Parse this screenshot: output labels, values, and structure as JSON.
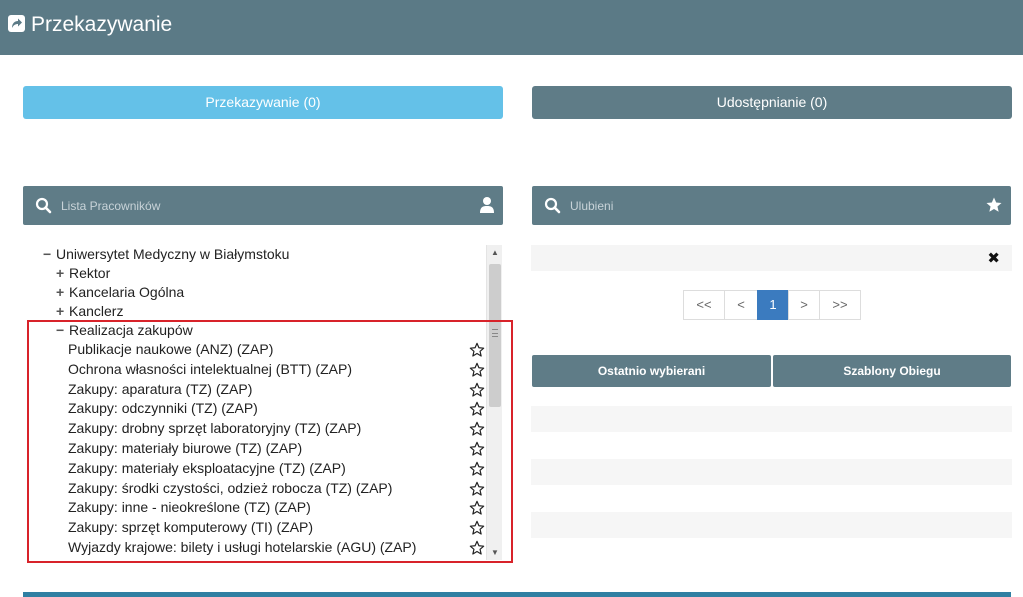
{
  "header": {
    "title": "Przekazywanie",
    "icon": "share-arrow-icon"
  },
  "actions": {
    "transfer_label": "Przekazywanie (0)",
    "share_label": "Udostępnianie (0)"
  },
  "employees_search": {
    "placeholder": "Lista Pracowników",
    "icon": "user-icon"
  },
  "favorites_search": {
    "placeholder": "Ulubieni",
    "icon": "star-icon"
  },
  "tree": {
    "root": "Uniwersytet Medyczny w Białymstoku",
    "nodes": [
      {
        "label": "Rektor",
        "toggle": "+"
      },
      {
        "label": "Kancelaria Ogólna",
        "toggle": "+"
      },
      {
        "label": "Kanclerz",
        "toggle": "+"
      },
      {
        "label": "Realizacja zakupów",
        "toggle": "−"
      }
    ],
    "items": [
      "Publikacje naukowe (ANZ) (ZAP)",
      "Ochrona własności intelektualnej (BTT) (ZAP)",
      "Zakupy: aparatura (TZ) (ZAP)",
      "Zakupy: odczynniki (TZ) (ZAP)",
      "Zakupy: drobny sprzęt laboratoryjny (TZ) (ZAP)",
      "Zakupy: materiały biurowe (TZ) (ZAP)",
      "Zakupy: materiały eksploatacyjne (TZ) (ZAP)",
      "Zakupy: środki czystości, odzież robocza (TZ) (ZAP)",
      "Zakupy: inne - nieokreślone (TZ) (ZAP)",
      "Zakupy: sprzęt komputerowy (TI) (ZAP)",
      "Wyjazdy krajowe: bilety i usługi hotelarskie (AGU) (ZAP)"
    ]
  },
  "favorites": {
    "remove_icon": "close-icon"
  },
  "pagination": {
    "first": "<<",
    "prev": "<",
    "current": "1",
    "next": ">",
    "last": ">>"
  },
  "tabs": {
    "recent": "Ostatnio wybierani",
    "templates": "Szablony Obiegu"
  }
}
